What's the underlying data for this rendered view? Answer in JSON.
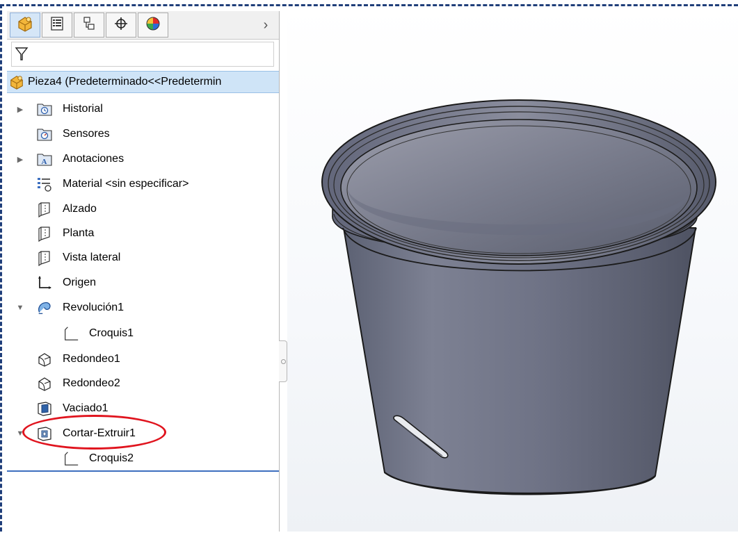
{
  "toolbar": {
    "tabs": [
      {
        "name": "featuremanager-tab-icon"
      },
      {
        "name": "propertymanager-tab-icon"
      },
      {
        "name": "configurationmanager-tab-icon"
      },
      {
        "name": "dimxpert-tab-icon"
      },
      {
        "name": "displaymanager-tab-icon"
      }
    ],
    "more_arrow": "›"
  },
  "root": {
    "label": "Pieza4  (Predeterminado<<Predetermin"
  },
  "tree": [
    {
      "label": "Historial",
      "icon": "history-folder-icon",
      "expand": "collapsed"
    },
    {
      "label": "Sensores",
      "icon": "sensors-folder-icon",
      "expand": "none"
    },
    {
      "label": "Anotaciones",
      "icon": "annotations-folder-icon",
      "expand": "collapsed"
    },
    {
      "label": "Material <sin especificar>",
      "icon": "material-icon",
      "expand": "none"
    },
    {
      "label": "Alzado",
      "icon": "plane-icon",
      "expand": "none"
    },
    {
      "label": "Planta",
      "icon": "plane-icon",
      "expand": "none"
    },
    {
      "label": "Vista lateral",
      "icon": "plane-icon",
      "expand": "none"
    },
    {
      "label": "Origen",
      "icon": "origin-icon",
      "expand": "none"
    },
    {
      "label": "Revolución1",
      "icon": "revolve-icon",
      "expand": "expanded"
    },
    {
      "label": "Croquis1",
      "icon": "sketch-icon",
      "expand": "none",
      "child": true
    },
    {
      "label": "Redondeo1",
      "icon": "fillet-icon",
      "expand": "none"
    },
    {
      "label": "Redondeo2",
      "icon": "fillet-icon",
      "expand": "none"
    },
    {
      "label": "Vaciado1",
      "icon": "shell-icon",
      "expand": "none"
    },
    {
      "label": "Cortar-Extruir1",
      "icon": "cut-extrude-icon",
      "expand": "expanded",
      "highlighted": true
    },
    {
      "label": "Croquis2",
      "icon": "sketch-icon",
      "expand": "none",
      "child": true
    }
  ],
  "colors": {
    "frame": "#1f3e7a",
    "highlight_ellipse": "#e0141e",
    "root_selection": "#cfe4f7",
    "model_body": "#6c7283"
  }
}
